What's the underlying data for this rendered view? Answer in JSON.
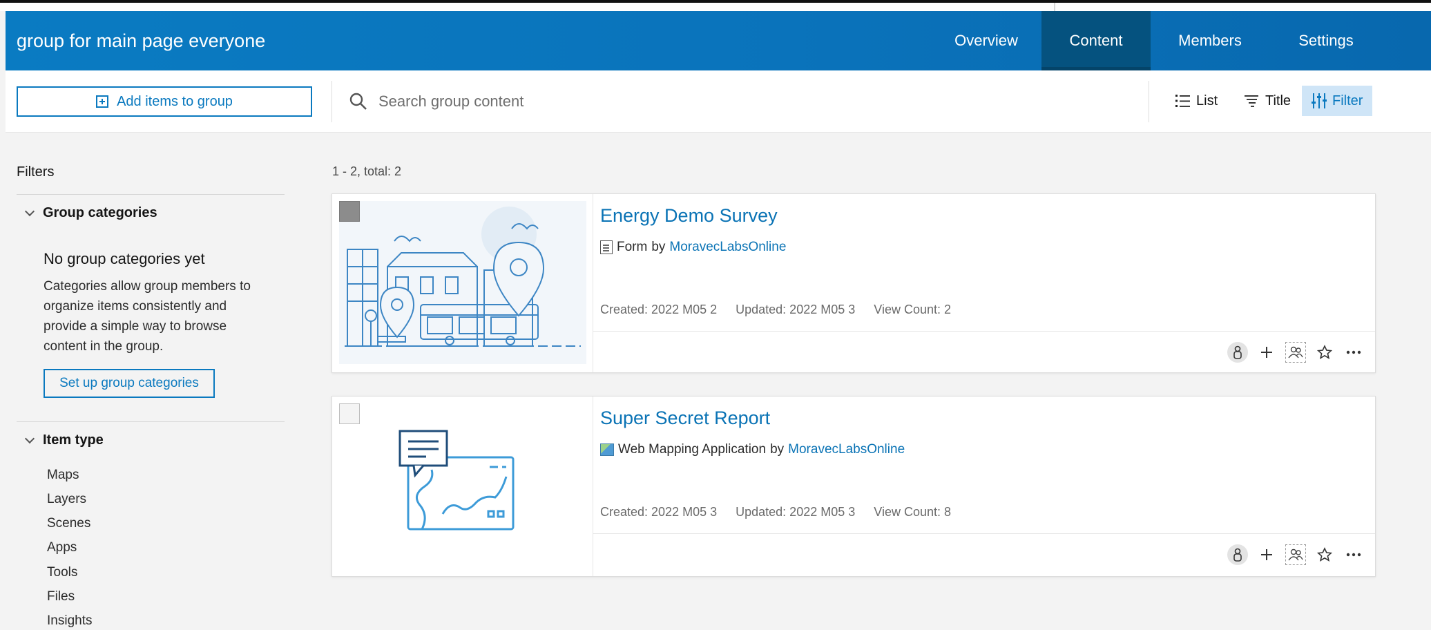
{
  "header": {
    "group_title": "group for main page everyone",
    "tabs": [
      {
        "label": "Overview",
        "active": false
      },
      {
        "label": "Content",
        "active": true
      },
      {
        "label": "Members",
        "active": false
      },
      {
        "label": "Settings",
        "active": false
      }
    ]
  },
  "toolbar": {
    "add_items_label": "Add items to group",
    "search_placeholder": "Search group content",
    "view_label": "List",
    "sort_label": "Title",
    "filter_label": "Filter"
  },
  "sidebar": {
    "filters_title": "Filters",
    "group_categories": {
      "heading": "Group categories",
      "empty_title": "No group categories yet",
      "empty_desc": "Categories allow group members to organize items consistently and provide a simple way to browse content in the group.",
      "setup_button": "Set up group categories"
    },
    "item_type": {
      "heading": "Item type",
      "items": [
        "Maps",
        "Layers",
        "Scenes",
        "Apps",
        "Tools",
        "Files",
        "Insights"
      ]
    }
  },
  "results": {
    "count_text": "1 - 2, total: 2",
    "items": [
      {
        "title": "Energy Demo Survey",
        "type_label": "Form",
        "by": "by",
        "owner": "MoravecLabsOnline",
        "created": "Created: 2022 M05 2",
        "updated": "Updated: 2022 M05 3",
        "views": "View Count: 2",
        "icon": "form-icon",
        "selected": true
      },
      {
        "title": "Super Secret Report",
        "type_label": "Web Mapping Application",
        "by": "by",
        "owner": "MoravecLabsOnline",
        "created": "Created: 2022 M05 3",
        "updated": "Updated: 2022 M05 3",
        "views": "View Count: 8",
        "icon": "web-app-icon",
        "selected": false
      }
    ]
  },
  "colors": {
    "header_blue": "#0a73bb",
    "active_tab": "#05527f",
    "link_blue": "#0a73b5",
    "filter_active_bg": "#cfe5f7"
  }
}
